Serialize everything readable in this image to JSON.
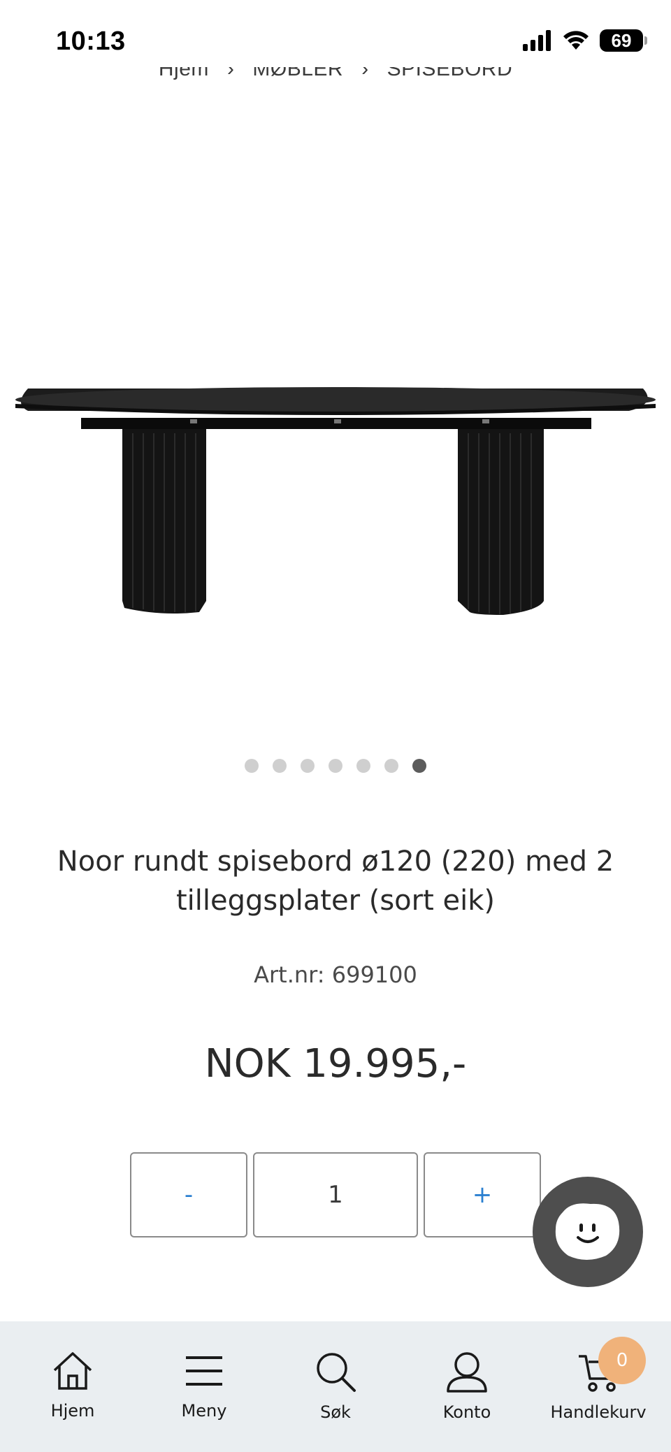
{
  "status_bar": {
    "time": "10:13",
    "battery": "69"
  },
  "breadcrumb": {
    "items": [
      "Hjem",
      "MØBLER",
      "SPISEBORD"
    ]
  },
  "product": {
    "image_alt": "",
    "title": "Noor rundt spisebord ø120 (220) med 2 tilleggsplater (sort eik)",
    "art_nr": "Art.nr: 699100",
    "price": "NOK 19.995,-",
    "gallery": {
      "count": 7,
      "active_index": 6
    }
  },
  "quantity": {
    "minus": "-",
    "value": "1",
    "plus": "+"
  },
  "nav": {
    "items": [
      {
        "label": "Hjem",
        "icon": "home-icon"
      },
      {
        "label": "Meny",
        "icon": "menu-icon"
      },
      {
        "label": "Søk",
        "icon": "search-icon"
      },
      {
        "label": "Konto",
        "icon": "user-icon"
      },
      {
        "label": "Handlekurv",
        "icon": "cart-icon"
      }
    ],
    "cart_count": "0"
  },
  "colors": {
    "accent": "#2a7fd0",
    "badge": "#f0b27a",
    "nav_bg": "#eaeef1",
    "chat_bg": "#4e4e4e"
  }
}
